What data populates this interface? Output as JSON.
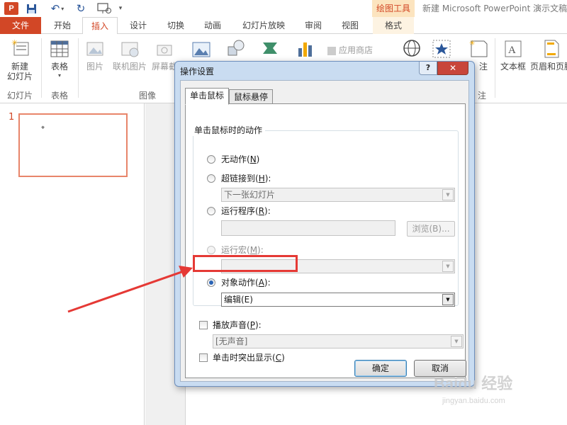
{
  "titlebar": {
    "app_logo": "P",
    "context_group": "绘图工具",
    "window_title": "新建 Microsoft PowerPoint 演示文稿"
  },
  "tabs": [
    "文件",
    "开始",
    "插入",
    "设计",
    "切换",
    "动画",
    "幻灯片放映",
    "审阅",
    "视图",
    "格式"
  ],
  "active_tab": "插入",
  "ribbon": {
    "new_slide": "新建\n幻灯片",
    "table": "表格",
    "picture": "图片",
    "online_picture": "联机图片",
    "screenshot": "屏幕截",
    "app_store": "应用商店",
    "notes_suffix": "注",
    "textbox": "文本框",
    "header_footer": "页眉和页脚",
    "groups": {
      "slides": "幻灯片",
      "tables": "表格",
      "images": "图像",
      "comments_suffix": "注"
    }
  },
  "thumbnails": {
    "slide_number": "1",
    "glyph": "⌖"
  },
  "dialog": {
    "title": "操作设置",
    "help": "?",
    "close": "✕",
    "tabs": [
      "单击鼠标",
      "鼠标悬停"
    ],
    "section_title": "单击鼠标时的动作",
    "options": {
      "none": {
        "text": "无动作(",
        "key": "N",
        "end": ")"
      },
      "hyperlink": {
        "text": "超链接到(",
        "key": "H",
        "end": "):"
      },
      "hyperlink_value": "下一张幻灯片",
      "run_program": {
        "text": "运行程序(",
        "key": "R",
        "end": "):"
      },
      "browse": "浏览(B)...",
      "run_macro": {
        "text": "运行宏(",
        "key": "M",
        "end": "):"
      },
      "object_action": {
        "text": "对象动作(",
        "key": "A",
        "end": "):"
      },
      "object_action_value": "编辑(E)"
    },
    "play_sound": {
      "text": "播放声音(",
      "key": "P",
      "end": "):"
    },
    "sound_value": "[无声音]",
    "highlight_click": {
      "text": "单击时突出显示(",
      "key": "C",
      "end": ")"
    },
    "ok": "确定",
    "cancel": "取消"
  },
  "watermark": {
    "brand": "Baidu 经验",
    "url": "jingyan.baidu.com"
  },
  "colors": {
    "accent": "#d24726",
    "highlight_box": "#e53935",
    "arrow": "#e53935"
  }
}
